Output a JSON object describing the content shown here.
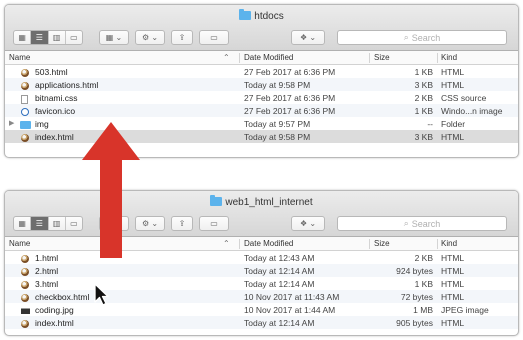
{
  "top_window": {
    "title": "htdocs",
    "search_placeholder": "Search",
    "columns": {
      "name": "Name",
      "date": "Date Modified",
      "size": "Size",
      "kind": "Kind"
    },
    "files": [
      {
        "icon": "html",
        "name": "503.html",
        "date": "27 Feb 2017 at 6:36 PM",
        "size": "1 KB",
        "kind": "HTML"
      },
      {
        "icon": "html",
        "name": "applications.html",
        "date": "Today at 9:58 PM",
        "size": "3 KB",
        "kind": "HTML"
      },
      {
        "icon": "css",
        "name": "bitnami.css",
        "date": "27 Feb 2017 at 6:36 PM",
        "size": "2 KB",
        "kind": "CSS source"
      },
      {
        "icon": "ico",
        "name": "favicon.ico",
        "date": "27 Feb 2017 at 6:36 PM",
        "size": "1 KB",
        "kind": "Windo...n image"
      },
      {
        "icon": "folder",
        "name": "img",
        "date": "Today at 9:57 PM",
        "size": "--",
        "kind": "Folder"
      },
      {
        "icon": "html",
        "name": "index.html",
        "date": "Today at 9:58 PM",
        "size": "3 KB",
        "kind": "HTML",
        "selected": true
      }
    ]
  },
  "bottom_window": {
    "title": "web1_html_internet",
    "search_placeholder": "Search",
    "columns": {
      "name": "Name",
      "date": "Date Modified",
      "size": "Size",
      "kind": "Kind"
    },
    "files": [
      {
        "icon": "html",
        "name": "1.html",
        "date": "Today at 12:43 AM",
        "size": "2 KB",
        "kind": "HTML"
      },
      {
        "icon": "html",
        "name": "2.html",
        "date": "Today at 12:14 AM",
        "size": "924 bytes",
        "kind": "HTML"
      },
      {
        "icon": "html",
        "name": "3.html",
        "date": "Today at 12:14 AM",
        "size": "1 KB",
        "kind": "HTML"
      },
      {
        "icon": "html",
        "name": "checkbox.html",
        "date": "10 Nov 2017 at 11:43 AM",
        "size": "72 bytes",
        "kind": "HTML"
      },
      {
        "icon": "jpg",
        "name": "coding.jpg",
        "date": "10 Nov 2017 at 1:44 AM",
        "size": "1 MB",
        "kind": "JPEG image"
      },
      {
        "icon": "html",
        "name": "index.html",
        "date": "Today at 12:14 AM",
        "size": "905 bytes",
        "kind": "HTML"
      }
    ]
  },
  "colors": {
    "arrow": "#d8342a",
    "folder": "#5cb3ec",
    "selection": "#dcdcdc"
  }
}
